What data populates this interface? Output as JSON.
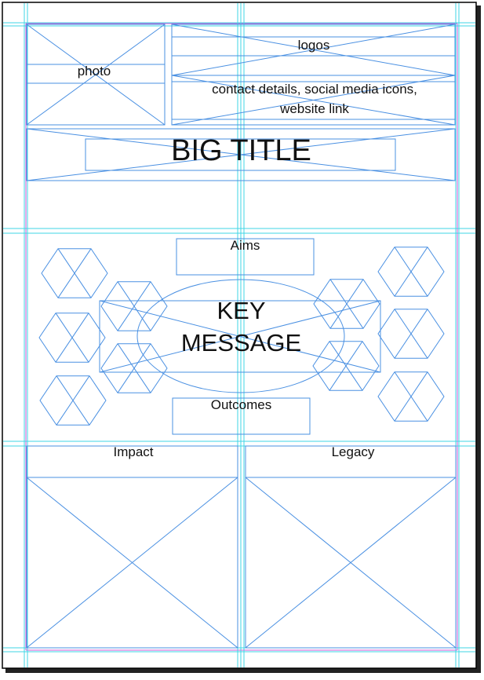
{
  "labels": {
    "photo": "photo",
    "logos": "logos",
    "contact_line1": "contact details, social media icons,",
    "contact_line2": "website link",
    "title": "BIG TITLE",
    "aims": "Aims",
    "key_line1": "KEY",
    "key_line2": "MESSAGE",
    "outcomes": "Outcomes",
    "impact": "Impact",
    "legacy": "Legacy"
  },
  "colors": {
    "placeholder_stroke": "#4a90e2",
    "guide_cyan": "#3fd6e6",
    "margin_magenta": "#d05ad8",
    "page_border": "#000000",
    "page_shadow": "#222222"
  }
}
